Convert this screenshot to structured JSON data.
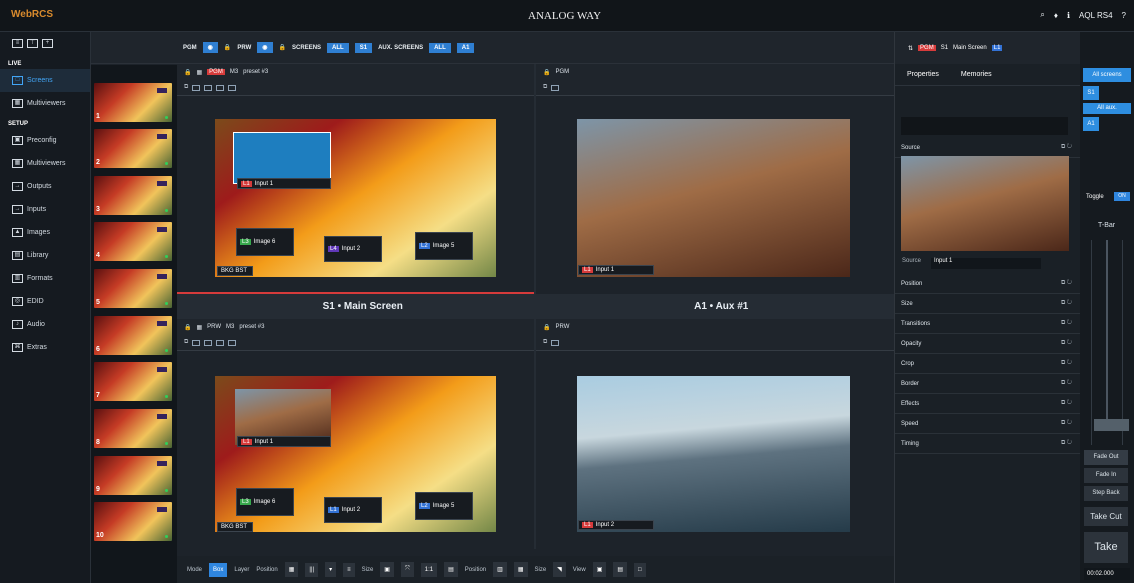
{
  "app": {
    "title": "WebRCS",
    "brand": "ANALOG WAY",
    "user": "AQL RS4"
  },
  "colors": {
    "accent": "#2f86df",
    "orange": "#d88a2d",
    "red": "#d63b3b",
    "green": "#37a84d",
    "blue": "#3372d5",
    "purple": "#6038b8"
  },
  "nav": {
    "live": "LIVE",
    "setup": "SETUP",
    "items": [
      {
        "label": "Screens",
        "icon": "monitor-icon"
      },
      {
        "label": "Multiviewers",
        "icon": "grid-icon"
      },
      {
        "label": "Preconfig",
        "icon": "layout-icon"
      },
      {
        "label": "Multiviewers",
        "icon": "grid-icon"
      },
      {
        "label": "Outputs",
        "icon": "output-icon"
      },
      {
        "label": "Inputs",
        "icon": "input-icon"
      },
      {
        "label": "Images",
        "icon": "image-icon"
      },
      {
        "label": "Library",
        "icon": "folder-icon"
      },
      {
        "label": "Formats",
        "icon": "format-icon"
      },
      {
        "label": "EDID",
        "icon": "chip-icon"
      },
      {
        "label": "Audio",
        "icon": "audio-icon"
      },
      {
        "label": "Extras",
        "icon": "extras-icon"
      }
    ]
  },
  "toolbar": {
    "pgm": "PGM",
    "prw": "PRW",
    "screens": "SCREENS",
    "all": "ALL",
    "s1": "S1",
    "aux": "AUX. SCREENS",
    "all2": "ALL",
    "a1": "A1"
  },
  "right": {
    "header": "PGM",
    "screen": "S1",
    "screen_name": "Main Screen",
    "l1": "L1",
    "tabs": [
      "Properties",
      "Memories"
    ],
    "props": [
      "Source",
      "Position",
      "Size",
      "Transitions",
      "Opacity",
      "Crop",
      "Border",
      "Effects",
      "Speed",
      "Timing"
    ],
    "source_value": "Input 1",
    "source_label": "Source"
  },
  "far": {
    "all_screens": "All screens",
    "s1": "S1",
    "all_aux": "All aux.",
    "a1": "A1",
    "toggle": "Toggle",
    "on": "ON",
    "tbar": "T-Bar",
    "fade_out": "Fade Out",
    "fade_in": "Fade In",
    "step_back": "Step Back",
    "take_cut": "Take Cut",
    "take": "Take",
    "duration": "00:02.000"
  },
  "views": {
    "top_left": {
      "prefix": "PGM",
      "m": "M3",
      "preset": "preset #3"
    },
    "top_right": {
      "prefix": "PGM"
    },
    "bottom_left": {
      "prefix": "PRW",
      "m": "M3",
      "preset": "preset #3"
    },
    "bottom_right": {
      "prefix": "PRW"
    },
    "main_screen": "S1 • Main Screen",
    "aux_screen": "A1 • Aux #1"
  },
  "layers": {
    "input1": "Input 1",
    "image6": "Image 6",
    "input2": "Input 2",
    "image5": "Image 5",
    "bkg": "BKG BST"
  },
  "thumbs": [
    "1",
    "2",
    "3",
    "4",
    "5",
    "6",
    "7",
    "8",
    "9",
    "10"
  ],
  "bottombar": {
    "mode": "Mode",
    "box": "Box",
    "layer": "Layer",
    "position": "Position",
    "size": "Size",
    "one_to_one": "1:1",
    "position2": "Position",
    "size2": "Size",
    "view": "View"
  }
}
